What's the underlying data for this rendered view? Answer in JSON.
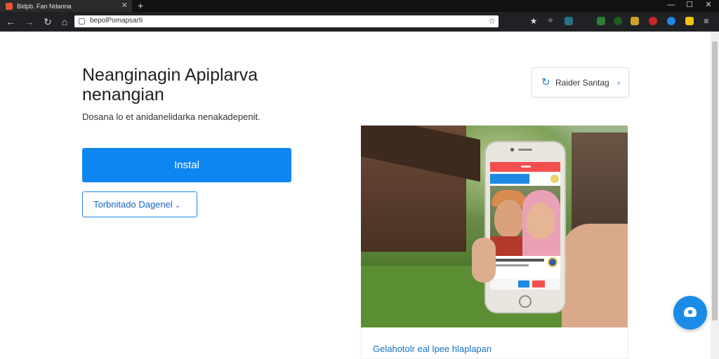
{
  "browser": {
    "tab_title": "Bidpb. Fan Ndanna",
    "new_tab": "+",
    "window_controls": [
      "—",
      "☐",
      "✕"
    ],
    "address": "bepolPomapsarti",
    "nav_icons": [
      "back-arrow-icon",
      "forward-arrow-icon",
      "reload-icon",
      "home-icon"
    ]
  },
  "hero": {
    "title": "Neanginagin Apiplarva nenangian",
    "subtitle": "Dosana lo et anidanelidarka nenakadepenit.",
    "install_label": "Instal",
    "dropdown_label": "Torbnitado Dagenel"
  },
  "refresh_card": {
    "label": "Raider Santag",
    "arrow": "›"
  },
  "promo": {
    "caption": "Gelahotolr eal lpee hlaplapan"
  },
  "colors": {
    "accent": "#0d86f2",
    "outline": "#1e88e5",
    "app_red": "#f44f4f",
    "chrome_dark": "#202124"
  }
}
